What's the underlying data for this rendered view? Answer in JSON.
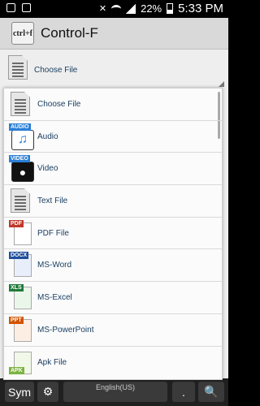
{
  "status_bar": {
    "battery": "22%",
    "time": "5:33 PM"
  },
  "app": {
    "icon_text": "ctrl+f",
    "title": "Control-F"
  },
  "selector": {
    "label": "Choose File"
  },
  "dropdown": {
    "items": [
      {
        "label": "Choose File",
        "icon": "document-icon"
      },
      {
        "label": "Audio",
        "icon": "audio-icon",
        "tag": "AUDIO"
      },
      {
        "label": "Video",
        "icon": "video-icon",
        "tag": "VIDEO"
      },
      {
        "label": "Text File",
        "icon": "text-file-icon"
      },
      {
        "label": "PDF File",
        "icon": "pdf-icon",
        "tag": "PDF"
      },
      {
        "label": "MS-Word",
        "icon": "word-icon",
        "tag": "DOCX"
      },
      {
        "label": "MS-Excel",
        "icon": "excel-icon",
        "tag": "XLS"
      },
      {
        "label": "MS-PowerPoint",
        "icon": "powerpoint-icon",
        "tag": "PPT"
      },
      {
        "label": "Apk File",
        "icon": "apk-icon",
        "tag": "APK"
      }
    ]
  },
  "keyboard": {
    "sym": "Sym",
    "space_label": "English(US)",
    "dot": "."
  },
  "colors": {
    "label": "#1a3f62",
    "pdf": "#c0392b",
    "word": "#1f4e9c",
    "excel": "#1f7a3a",
    "ppt": "#d35400",
    "apk": "#7cb342"
  }
}
